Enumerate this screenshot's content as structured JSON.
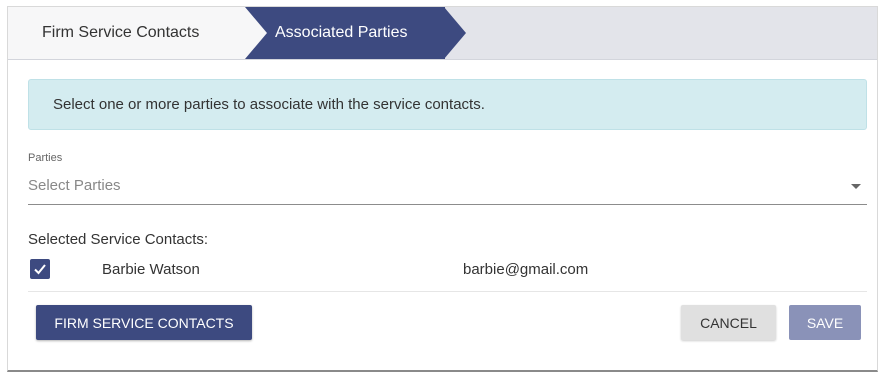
{
  "wizard": {
    "steps": [
      {
        "label": "Firm Service Contacts"
      },
      {
        "label": "Associated Parties"
      }
    ]
  },
  "info": {
    "message": "Select one or more parties to associate with the service contacts."
  },
  "parties": {
    "label": "Parties",
    "placeholder": "Select Parties"
  },
  "contacts": {
    "section_label": "Selected Service Contacts:",
    "items": [
      {
        "name": "Barbie Watson",
        "email": "barbie@gmail.com",
        "checked": true
      }
    ]
  },
  "footer": {
    "firm_button": "FIRM SERVICE CONTACTS",
    "cancel_button": "CANCEL",
    "save_button": "SAVE"
  },
  "colors": {
    "primary": "#3d4a80",
    "info_bg": "#d4ecf0",
    "save_disabled": "#8a92b8"
  },
  "icons": {
    "checkbox": "check-icon",
    "dropdown": "caret-down-icon"
  }
}
